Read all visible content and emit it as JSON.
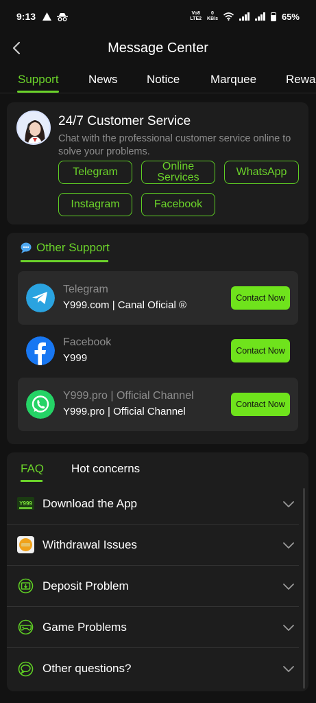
{
  "status_bar": {
    "time": "9:13",
    "network_top": "Vo8",
    "network_bottom": "LTE2",
    "speed_top": "0",
    "speed_bottom": "KB/s",
    "battery": "65%"
  },
  "header": {
    "title": "Message Center"
  },
  "tabs": [
    {
      "label": "Support",
      "active": true
    },
    {
      "label": "News"
    },
    {
      "label": "Notice"
    },
    {
      "label": "Marquee"
    },
    {
      "label": "Rewar"
    }
  ],
  "customer_service": {
    "title": "24/7 Customer Service",
    "description": "Chat with the professional customer service online to solve your problems.",
    "channels": [
      "Telegram",
      "Online Services",
      "WhatsApp",
      "Instagram",
      "Facebook"
    ]
  },
  "other_support": {
    "heading": "Other Support",
    "items": [
      {
        "name": "Telegram",
        "sub": "Y999.com | Canal Oficial ®",
        "button": "Contact Now"
      },
      {
        "name": "Facebook",
        "sub": "Y999",
        "button": "Contact Now"
      },
      {
        "name": "Y999.pro | Official Channel",
        "sub": "Y999.pro | Official Channel",
        "button": "Contact Now"
      }
    ]
  },
  "faq": {
    "tabs": [
      "FAQ",
      "Hot concerns"
    ],
    "items": [
      {
        "label": "Download the App",
        "icon": "y999-logo-icon"
      },
      {
        "label": "Withdrawal Issues",
        "icon": "withdrawal-icon"
      },
      {
        "label": "Deposit Problem",
        "icon": "deposit-icon"
      },
      {
        "label": "Game Problems",
        "icon": "gamepad-icon"
      },
      {
        "label": "Other questions?",
        "icon": "chat-question-icon"
      }
    ]
  },
  "colors": {
    "accent": "#6bd32a",
    "background": "#121212",
    "card": "#1d1d1d"
  }
}
